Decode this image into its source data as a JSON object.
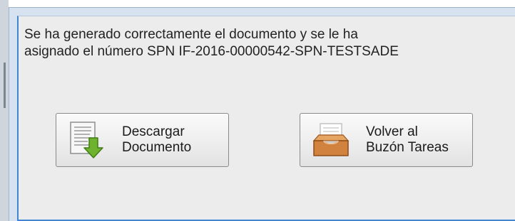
{
  "dialog": {
    "message_line1": "Se ha generado correctamente el documento y se le ha",
    "message_line2": "asignado el número SPN IF-2016-00000542-SPN-TESTSADE"
  },
  "buttons": {
    "download": {
      "line1": "Descargar",
      "line2": "Documento",
      "icon": "document-download-icon"
    },
    "inbox": {
      "line1": "Volver al",
      "line2": "Buzón Tareas",
      "icon": "inbox-tray-icon"
    }
  },
  "colors": {
    "dialog_border": "#3e86d3",
    "dialog_bg": "#ececec",
    "download_arrow": "#6fb22f",
    "inbox_tray": "#d0823e"
  }
}
